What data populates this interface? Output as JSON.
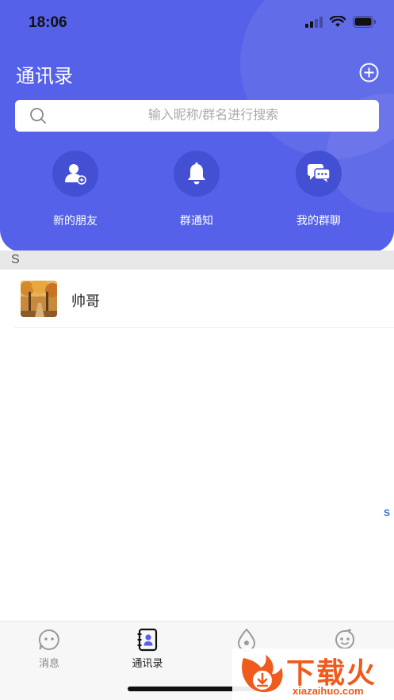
{
  "status_bar": {
    "time": "18:06"
  },
  "header": {
    "title": "通讯录"
  },
  "search": {
    "placeholder": "输入昵称/群名进行搜索"
  },
  "quick_actions": [
    {
      "label": "新的朋友",
      "icon": "add-friend-icon"
    },
    {
      "label": "群通知",
      "icon": "bell-icon"
    },
    {
      "label": "我的群聊",
      "icon": "group-chat-icon"
    }
  ],
  "contacts": {
    "section_letter": "S",
    "items": [
      {
        "name": "帅哥",
        "avatar": "autumn-trees-photo"
      }
    ],
    "index_letter": "S"
  },
  "tabbar": {
    "tabs": [
      {
        "label": "消息",
        "icon": "message-face-icon",
        "active": false
      },
      {
        "label": "通讯录",
        "icon": "contacts-book-icon",
        "active": true
      },
      {
        "label": "",
        "icon": "discover-drop-icon",
        "active": false
      },
      {
        "label": "",
        "icon": "profile-face-icon",
        "active": false
      }
    ]
  },
  "watermark": {
    "text": "下载火",
    "url": "xiazaihuo.com"
  },
  "colors": {
    "header_blue": "#5561e8",
    "circle_blue": "#4350d4",
    "watermark_orange": "#f05a1c"
  }
}
